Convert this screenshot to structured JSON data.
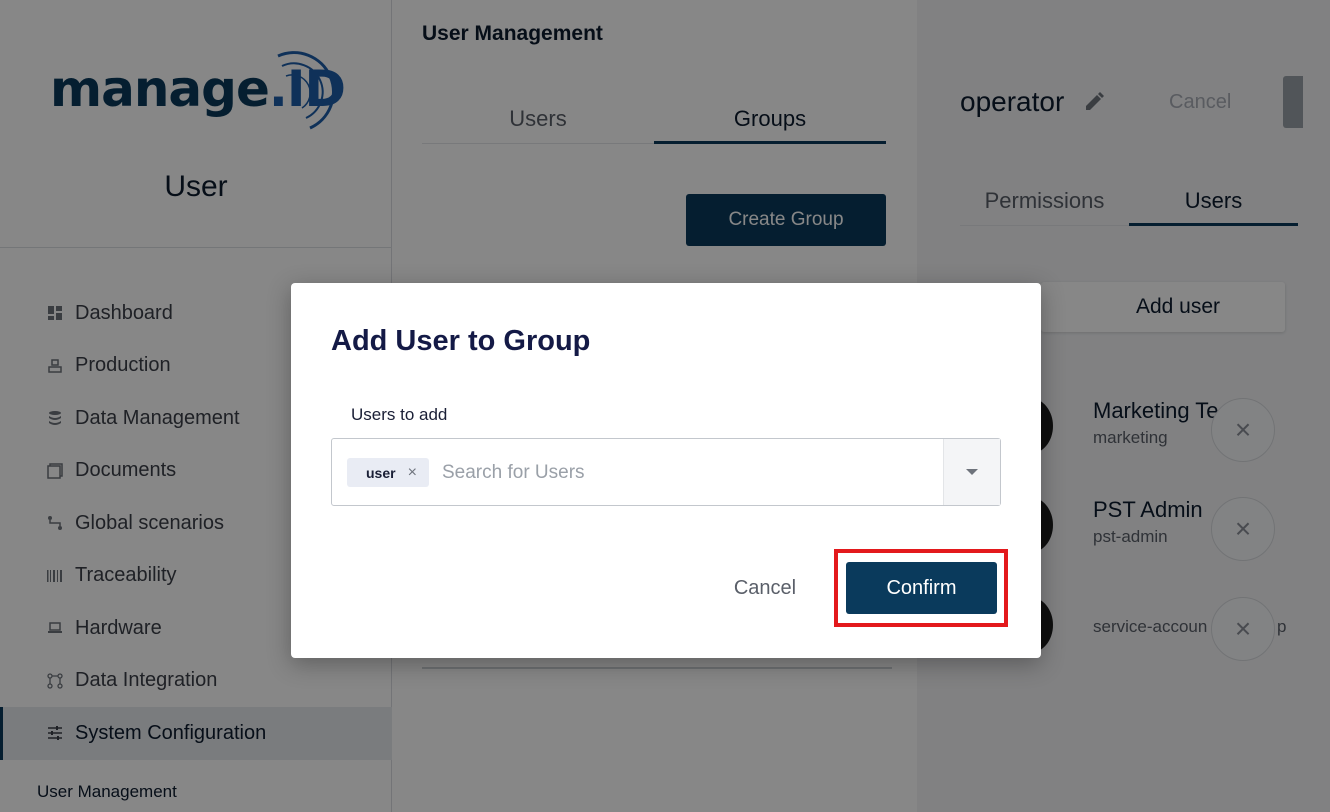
{
  "sidebar": {
    "logo": "manage.ID",
    "title": "User",
    "items": [
      {
        "label": "Dashboard",
        "icon": "dashboard-icon"
      },
      {
        "label": "Production",
        "icon": "production-icon"
      },
      {
        "label": "Data Management",
        "icon": "database-icon"
      },
      {
        "label": "Documents",
        "icon": "documents-icon"
      },
      {
        "label": "Global scenarios",
        "icon": "scenarios-icon"
      },
      {
        "label": "Traceability",
        "icon": "barcode-icon"
      },
      {
        "label": "Hardware",
        "icon": "hardware-icon"
      },
      {
        "label": "Data Integration",
        "icon": "integration-icon"
      },
      {
        "label": "System Configuration",
        "icon": "sliders-icon",
        "active": true
      }
    ],
    "sub_item": "User Management"
  },
  "middle": {
    "title": "User Management",
    "tabs": [
      {
        "label": "Users",
        "active": false
      },
      {
        "label": "Groups",
        "active": true
      }
    ],
    "create_button": "Create Group"
  },
  "right": {
    "group_name": "operator",
    "cancel_label": "Cancel",
    "tabs": [
      {
        "label": "Permissions",
        "active": false
      },
      {
        "label": "Users",
        "active": true
      }
    ],
    "add_user_button": "Add user",
    "members": [
      {
        "name": "Marketing Te",
        "sub": "marketing"
      },
      {
        "name": "PST Admin",
        "sub": "pst-admin"
      },
      {
        "name": "",
        "sub": "service-accoun"
      },
      {
        "trailing": "p"
      }
    ]
  },
  "dialog": {
    "title": "Add User to Group",
    "field_label": "Users to add",
    "selected_chip": "user",
    "chip_remove": "×",
    "search_placeholder": "Search for Users",
    "cancel_label": "Cancel",
    "confirm_label": "Confirm",
    "highlight_color": "#e3191c"
  },
  "colors": {
    "primary": "#0a3a5c",
    "overlay": "rgba(0,0,0,0.47)"
  }
}
